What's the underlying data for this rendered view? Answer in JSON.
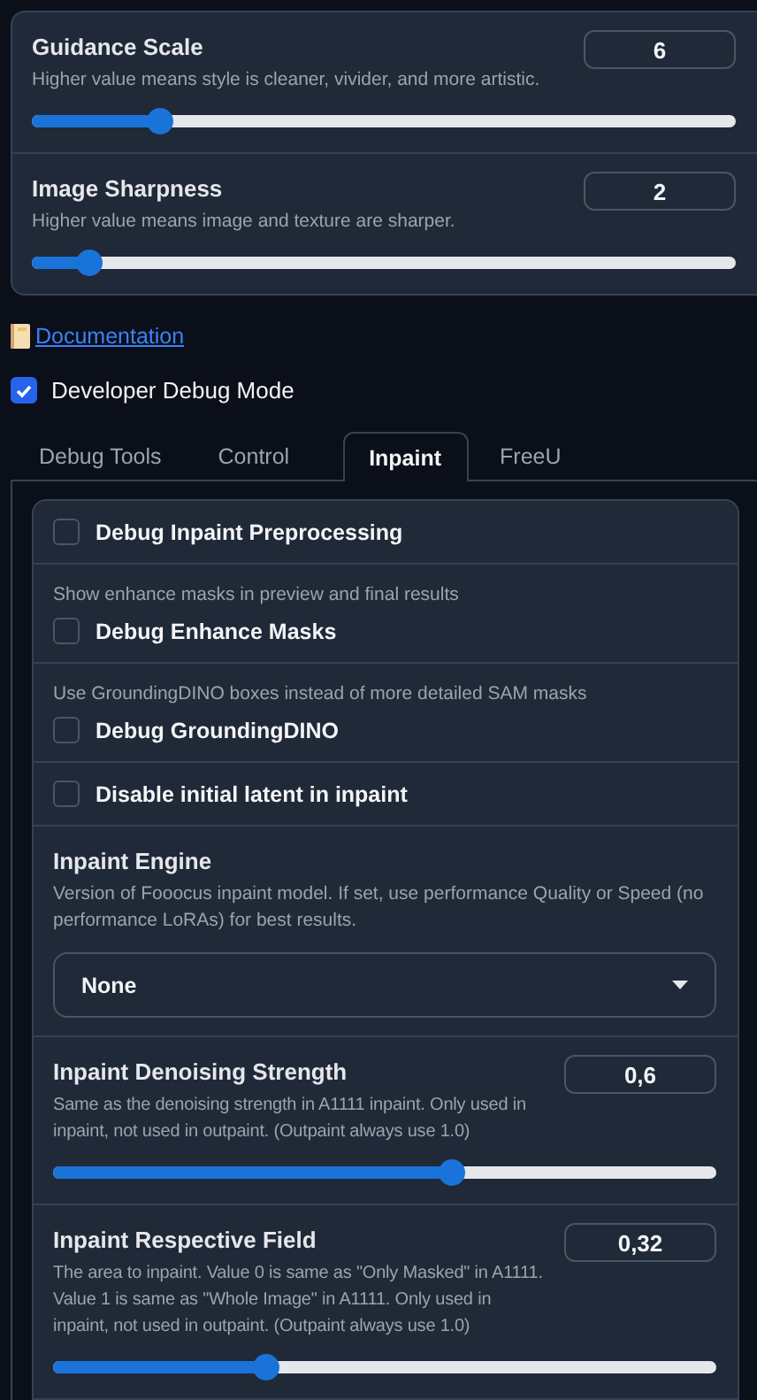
{
  "top_sliders": [
    {
      "label": "Guidance Scale",
      "info": "Higher value means style is cleaner, vivider, and more artistic.",
      "value": "6",
      "level": 0.18
    },
    {
      "label": "Image Sharpness",
      "info": "Higher value means image and texture are sharper.",
      "value": "2",
      "level": 0.08
    }
  ],
  "documentation_link": "Documentation",
  "developer_debug_mode": {
    "label": "Developer Debug Mode",
    "checked": true
  },
  "tabs": [
    {
      "label": "Debug Tools",
      "selected": false
    },
    {
      "label": "Control",
      "selected": false
    },
    {
      "label": "Inpaint",
      "selected": true
    },
    {
      "label": "FreeU",
      "selected": false
    }
  ],
  "inpaint_items": [
    {
      "kind": "checkbox",
      "label": "Debug Inpaint Preprocessing",
      "checked": false
    },
    {
      "kind": "checkbox",
      "info": "Show enhance masks in preview and final results",
      "label": "Debug Enhance Masks",
      "checked": false
    },
    {
      "kind": "checkbox",
      "info": "Use GroundingDINO boxes instead of more detailed SAM masks",
      "label": "Debug GroundingDINO",
      "checked": false
    },
    {
      "kind": "checkbox",
      "label": "Disable initial latent in inpaint",
      "checked": false
    },
    {
      "kind": "dropdown",
      "label": "Inpaint Engine",
      "info": "Version of Fooocus inpaint model. If set, use performance Quality or Speed (no performance LoRAs) for best results.",
      "value": "None"
    },
    {
      "kind": "slider",
      "label": "Inpaint Denoising Strength",
      "info": "Same as the denoising strength in A1111 inpaint. Only used in inpaint, not used in outpaint. (Outpaint always use 1.0)",
      "value": "0,6",
      "level": 0.6
    },
    {
      "kind": "slider",
      "label": "Inpaint Respective Field",
      "info": "The area to inpaint. Value 0 is same as \"Only Masked\" in A1111. Value 1 is same as \"Whole Image\" in A1111. Only used in inpaint, not used in outpaint. (Outpaint always use 1.0)",
      "value": "0,32",
      "level": 0.32
    }
  ]
}
